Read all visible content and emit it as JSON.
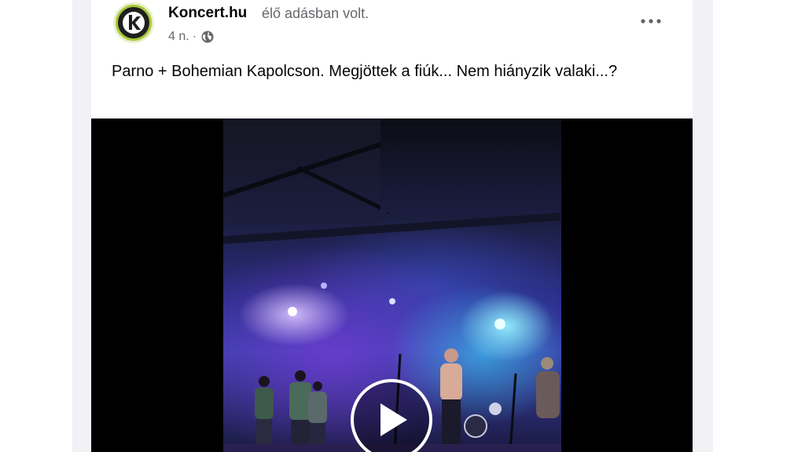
{
  "post": {
    "page_name": "Koncert.hu",
    "live_status": "élő adásban volt.",
    "timestamp": "4 n.",
    "separator": "·",
    "audience_icon": "globe-icon",
    "more_icon": "more-options-icon",
    "caption": "Parno + Bohemian Kapolcson. Megjöttek a fiúk... Nem hiányzik valaki...?"
  },
  "avatar": {
    "letter": "K",
    "ring_color": "#a8c838"
  },
  "video": {
    "play_icon": "play-icon"
  },
  "colors": {
    "name_text": "#050505",
    "secondary_text": "#65676b",
    "feed_background": "#f0f2f5",
    "video_background": "#000000"
  }
}
